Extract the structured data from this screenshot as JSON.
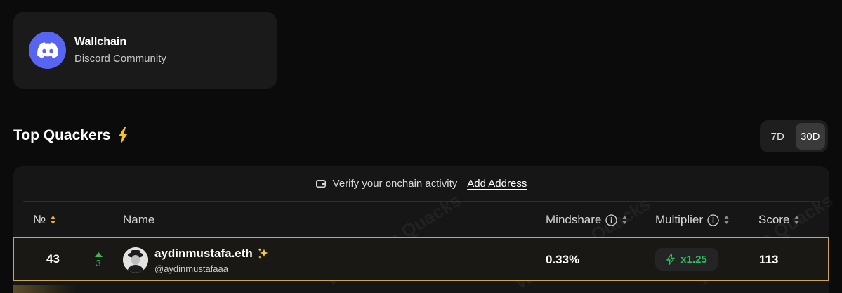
{
  "community": {
    "name": "Wallchain",
    "subtitle": "Discord Community",
    "icon": "discord-icon"
  },
  "section": {
    "title": "Top Quackers",
    "title_icon": "lightning-bolt-icon",
    "periods": [
      {
        "label": "7D",
        "active": false
      },
      {
        "label": "30D",
        "active": true
      }
    ]
  },
  "verify": {
    "text": "Verify your onchain activity",
    "link": "Add Address",
    "icon": "wallet-icon"
  },
  "table": {
    "columns": {
      "rank": "№",
      "name": "Name",
      "mindshare": "Mindshare",
      "multiplier": "Multiplier",
      "score": "Score"
    },
    "rows": [
      {
        "rank": "43",
        "rank_change": "3",
        "rank_direction": "up",
        "name": "aydinmustafa.eth",
        "handle": "@aydinmustafaaa",
        "mindshare": "0.33%",
        "multiplier": "x1.25",
        "score": "113"
      }
    ]
  },
  "watermark": "Wallchain Quacks",
  "colors": {
    "accent_green": "#2fbf5a",
    "highlight_border": "#c9a84f",
    "discord_blue": "#5865f2",
    "bolt_yellow": "#f5c518"
  }
}
